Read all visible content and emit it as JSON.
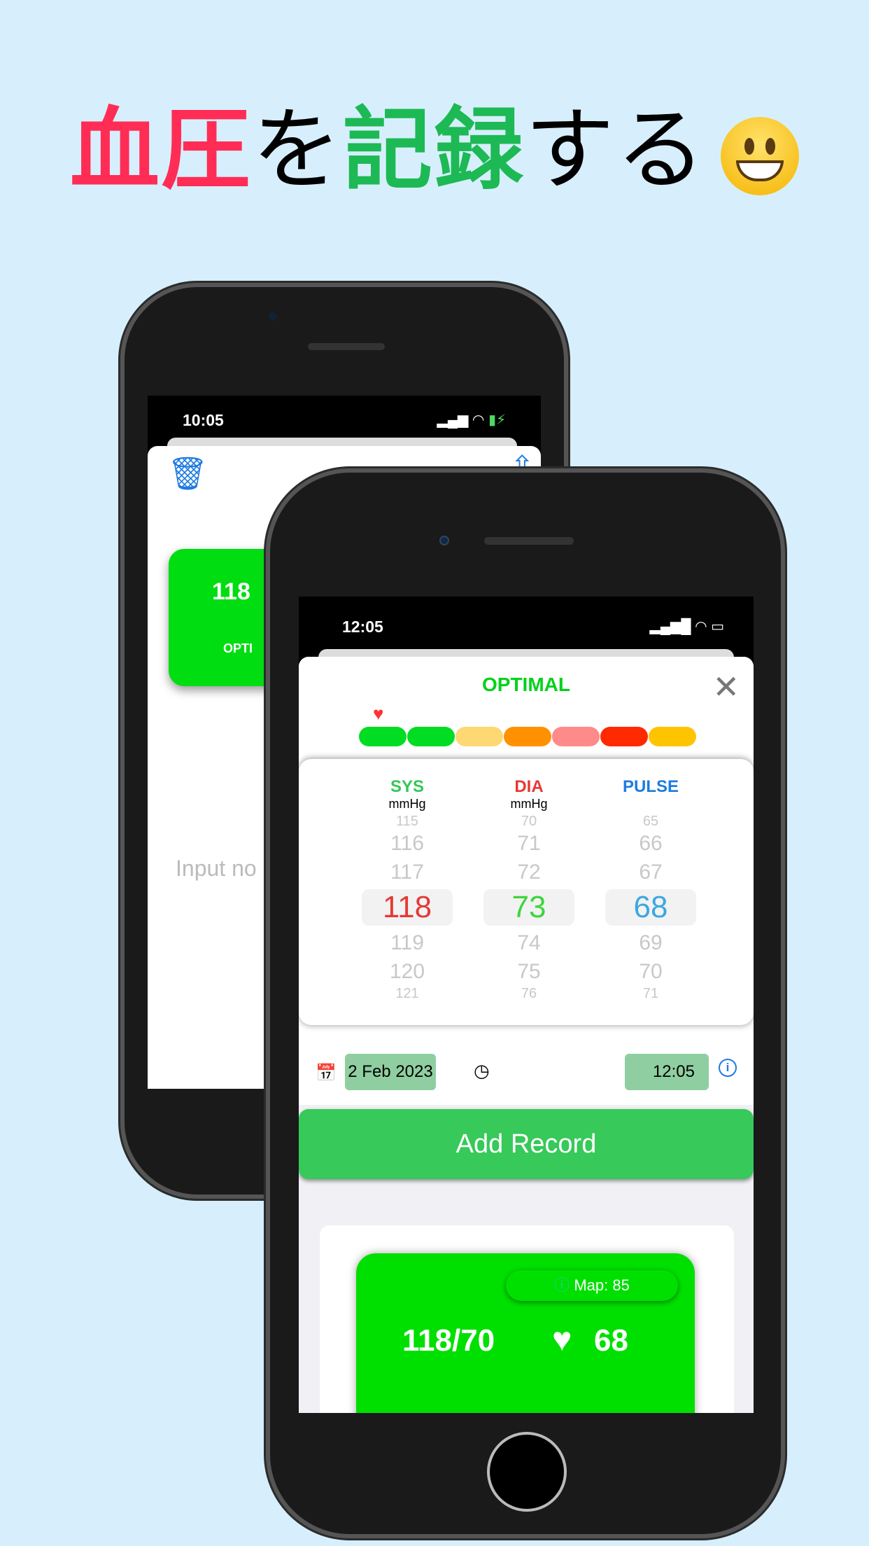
{
  "headline": {
    "part1": "血圧",
    "part2": "を",
    "part3": "記録",
    "part4": "する",
    "colors": {
      "part1": "#ff2d55",
      "part3": "#1db954"
    },
    "emoji": "grinning-face"
  },
  "back_phone": {
    "time": "10:05",
    "reading": "118",
    "category": "OPTI",
    "note_placeholder": "Input no"
  },
  "front_phone": {
    "time": "12:05",
    "category": "OPTIMAL",
    "category_color": "#00d21a",
    "scale_colors": [
      "#00dd22",
      "#00dd22",
      "#fdd873",
      "#ff9100",
      "#ff8a8a",
      "#ff2a00",
      "#ffc400"
    ],
    "scale_position_index": 0,
    "picker": {
      "columns": [
        {
          "label": "SYS",
          "unit": "mmHg",
          "label_color": "#34c759",
          "value_color": "#e53935",
          "above": [
            "115",
            "116",
            "117"
          ],
          "selected": "118",
          "below": [
            "119",
            "120",
            "121"
          ]
        },
        {
          "label": "DIA",
          "unit": "mmHg",
          "label_color": "#e53935",
          "value_color": "#3cd63c",
          "above": [
            "70",
            "71",
            "72"
          ],
          "selected": "73",
          "below": [
            "74",
            "75",
            "76"
          ]
        },
        {
          "label": "PULSE",
          "unit": "",
          "label_color": "#1e7be0",
          "value_color": "#3aa8e0",
          "above": [
            "65",
            "66",
            "67"
          ],
          "selected": "68",
          "below": [
            "69",
            "70",
            "71"
          ]
        }
      ]
    },
    "date": "2 Feb 2023",
    "time_value": "12:05",
    "add_button": "Add Record",
    "record": {
      "map": "Map: 85",
      "bp": "118/70",
      "pulse": "68"
    }
  }
}
